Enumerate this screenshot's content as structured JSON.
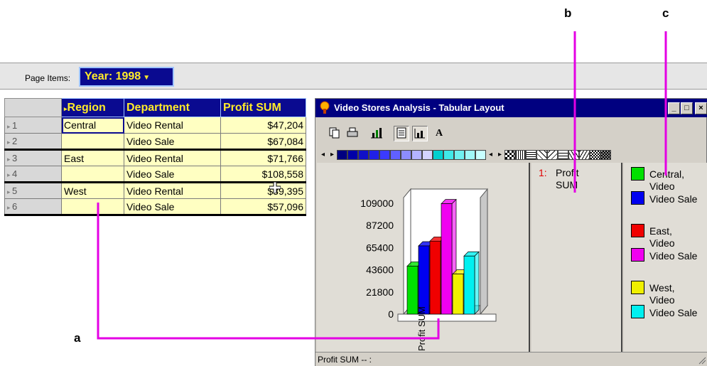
{
  "callouts": {
    "a": "a",
    "b": "b",
    "c": "c"
  },
  "colors": {
    "line": "#e400e4",
    "header_bg": "#0a0a90",
    "header_fg": "#ffeb2a",
    "cell_bg": "#ffffc2",
    "title_bg": "#000080"
  },
  "page_items": {
    "label": "Page Items:",
    "year_value": "Year: 1998"
  },
  "grid": {
    "columns": [
      "Region",
      "Department",
      "Profit SUM"
    ],
    "rows": [
      {
        "num": "1",
        "region": "Central",
        "department": "Video Rental",
        "profit": "$47,204"
      },
      {
        "num": "2",
        "region": "",
        "department": "Video Sale",
        "profit": "$67,084"
      },
      {
        "num": "3",
        "region": "East",
        "department": "Video Rental",
        "profit": "$71,766"
      },
      {
        "num": "4",
        "region": "",
        "department": "Video Sale",
        "profit": "$108,558"
      },
      {
        "num": "5",
        "region": "West",
        "department": "Video Rental",
        "profit": "$39,395"
      },
      {
        "num": "6",
        "region": "",
        "department": "Video Sale",
        "profit": "$57,096"
      }
    ]
  },
  "window": {
    "title": "Video Stores Analysis - Tabular Layout",
    "buttons": {
      "minimize": "_",
      "maximize": "□",
      "close": "×"
    },
    "status": "Profit SUM -- :",
    "toolbar_icons": [
      "copy-icon",
      "print-icon",
      "bar-chart-icon",
      "table-layout-icon",
      "chart-layout-icon",
      "font-icon"
    ],
    "palette_colors": [
      "#000080",
      "#0000a8",
      "#1010c8",
      "#2020e8",
      "#3a3aff",
      "#6060ff",
      "#8c8cff",
      "#b4b4ff",
      "#d4d4ff",
      "#00d0d0",
      "#40e8e8",
      "#70f0f0",
      "#a0f8f8",
      "#c8ffff"
    ]
  },
  "series_legend": {
    "index": "1:",
    "label_line1": "Profit",
    "label_line2": "SUM"
  },
  "category_legend": [
    {
      "line1": "Central,",
      "line2": "Video",
      "color": "#00e000"
    },
    {
      "line1": "Video Sale",
      "line2": "",
      "color": "#0000f0"
    },
    {
      "line1": "East,",
      "line2": "Video",
      "color": "#f00000"
    },
    {
      "line1": "Video Sale",
      "line2": "",
      "color": "#f000f0"
    },
    {
      "line1": "West,",
      "line2": "Video",
      "color": "#f0f000"
    },
    {
      "line1": "Video Sale",
      "line2": "",
      "color": "#00f0f0"
    }
  ],
  "chart_data": {
    "type": "bar",
    "ylim": [
      0,
      109000
    ],
    "yticks": [
      "109000",
      "87200",
      "65400",
      "43600",
      "21800",
      "0"
    ],
    "xlabel_tick": "Profit SUM",
    "categories": [
      "Central, Video Rental",
      "Central, Video Sale",
      "East, Video Rental",
      "East, Video Sale",
      "West, Video Rental",
      "West, Video Sale"
    ],
    "values": [
      47204,
      67084,
      71766,
      108558,
      39395,
      57096
    ],
    "colors": [
      "#00e000",
      "#0000f0",
      "#f00000",
      "#f000f0",
      "#f0f000",
      "#00f0f0"
    ]
  }
}
